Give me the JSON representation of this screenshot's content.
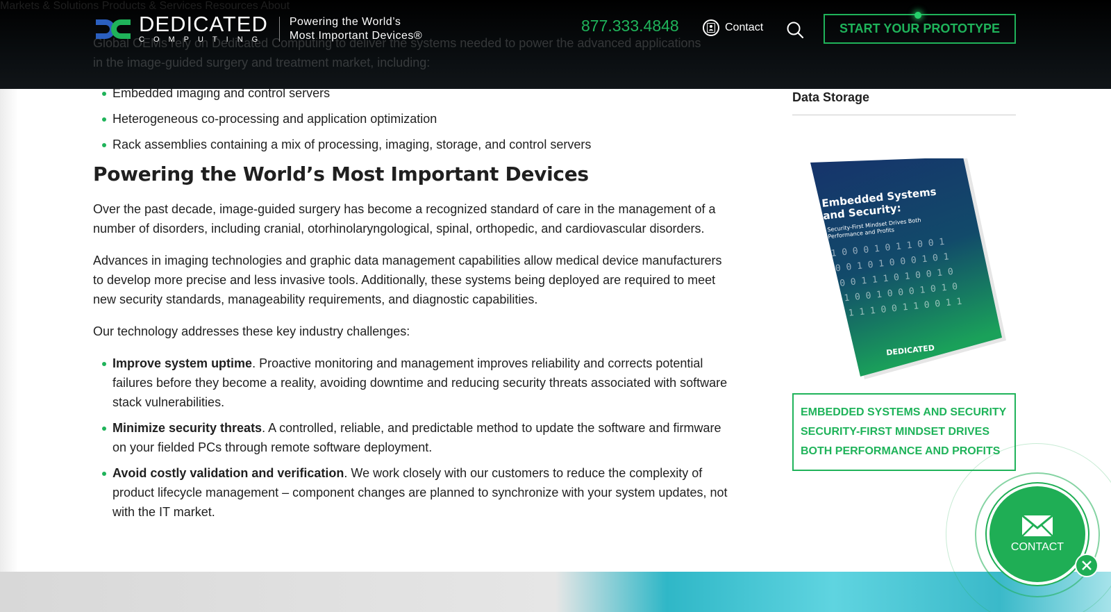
{
  "header": {
    "ghost_text": "Global OEMs rely on Dedicated Computing to deliver the systems needed to power the advanced applications in the image-guided surgery and treatment market, including:",
    "logo": {
      "name": "DEDICATED",
      "sub": "COMPUTING"
    },
    "tagline": {
      "line1": "Powering the World’s",
      "line2": "Most Important Devices®"
    },
    "phone": "877.333.4848",
    "contact_label": "Contact",
    "cta_label": "START YOUR PROTOTYPE",
    "nav": [
      "Markets & Solutions",
      "Products & Services",
      "Resources",
      "About"
    ]
  },
  "content": {
    "top_bullets": [
      "Embedded imaging and control servers",
      "Heterogeneous co-processing and application optimization",
      "Rack assemblies containing a mix of processing, imaging, storage, and control servers"
    ],
    "heading": "Powering the World’s Most Important Devices",
    "para1": "Over the past decade, image-guided surgery has become a recognized standard of care in the management of a number of disorders, including cranial, otorhinolaryngological, spinal, orthopedic, and cardiovascular disorders.",
    "para2": "Advances in imaging technologies and graphic data management capabilities allow medical device manufacturers to develop more precise and less invasive tools. Additionally, these systems being deployed are required to meet new security standards, manageability requirements, and diagnostic capabilities.",
    "para3": "Our technology addresses these key industry challenges:",
    "challenges": [
      {
        "bold": "Improve system uptime",
        "text": ". Proactive monitoring and management improves reliability and corrects potential failures before they become a reality, avoiding downtime and reducing security threats associated with software stack vulnerabilities."
      },
      {
        "bold": "Minimize security threats",
        "text": ". A controlled, reliable, and predictable method to update the software and firmware on your fielded PCs through remote software deployment."
      },
      {
        "bold": "Avoid costly validation and verification",
        "text": ". We work closely with our customers to reduce the complexity of product lifecycle management – component changes are planned to synchronize with your system updates, not with the IT market."
      }
    ]
  },
  "sidebar": {
    "item": "Data Storage",
    "book": {
      "title1": "Embedded Systems",
      "title2": "and Security:",
      "subtitle1": "Security-First Mindset Drives Both",
      "subtitle2": "Performance and Profits"
    },
    "link": "EMBEDDED SYSTEMS AND SECURITY SECURITY-FIRST MINDSET DRIVES BOTH PERFORMANCE AND PROFITS"
  },
  "float": {
    "contact_label": "CONTACT"
  },
  "colors": {
    "brand_green": "#1fb35a",
    "header_bg": "#000000",
    "text": "#1f1f1f"
  }
}
